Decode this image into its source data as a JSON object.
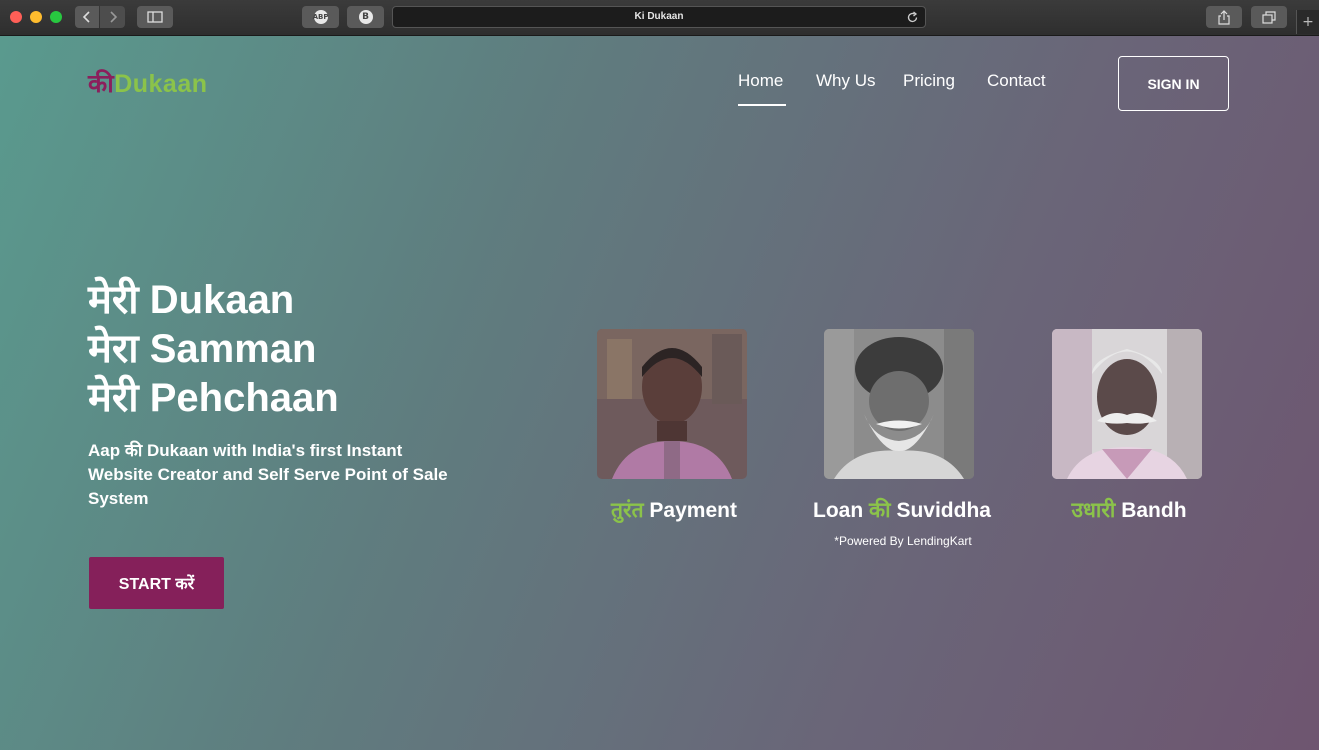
{
  "browser": {
    "page_title": "Ki Dukaan",
    "extension_1": "ABP",
    "extension_2": "B"
  },
  "logo": {
    "part1": "की",
    "part2": "Dukaan"
  },
  "nav": {
    "items": [
      {
        "label": "Home",
        "active": true
      },
      {
        "label": "Why Us",
        "active": false
      },
      {
        "label": "Pricing",
        "active": false
      },
      {
        "label": "Contact",
        "active": false
      }
    ],
    "signin_label": "SIGN IN"
  },
  "hero": {
    "lines": [
      "मेरी Dukaan",
      "मेरा Samman",
      "मेरी Pehchaan"
    ],
    "subtitle": "Aap की Dukaan with India's first Instant Website Creator and Self Serve Point of Sale System",
    "cta_label": "START करें"
  },
  "features": [
    {
      "highlight": "तुरंत",
      "text": "Payment"
    },
    {
      "prefix": "Loan",
      "highlight": "की",
      "text": "Suviddha",
      "note": "*Powered By LendingKart"
    },
    {
      "highlight": "उधारी",
      "text": "Bandh"
    }
  ],
  "colors": {
    "brand": "#85205a",
    "accent": "#8bc34a"
  },
  "icons": {
    "back": "chevron-left-icon",
    "forward": "chevron-right-icon",
    "sidebar": "sidebar-icon",
    "reload": "reload-icon",
    "share": "share-icon",
    "tabs": "tabs-icon",
    "new_tab": "plus-icon"
  }
}
